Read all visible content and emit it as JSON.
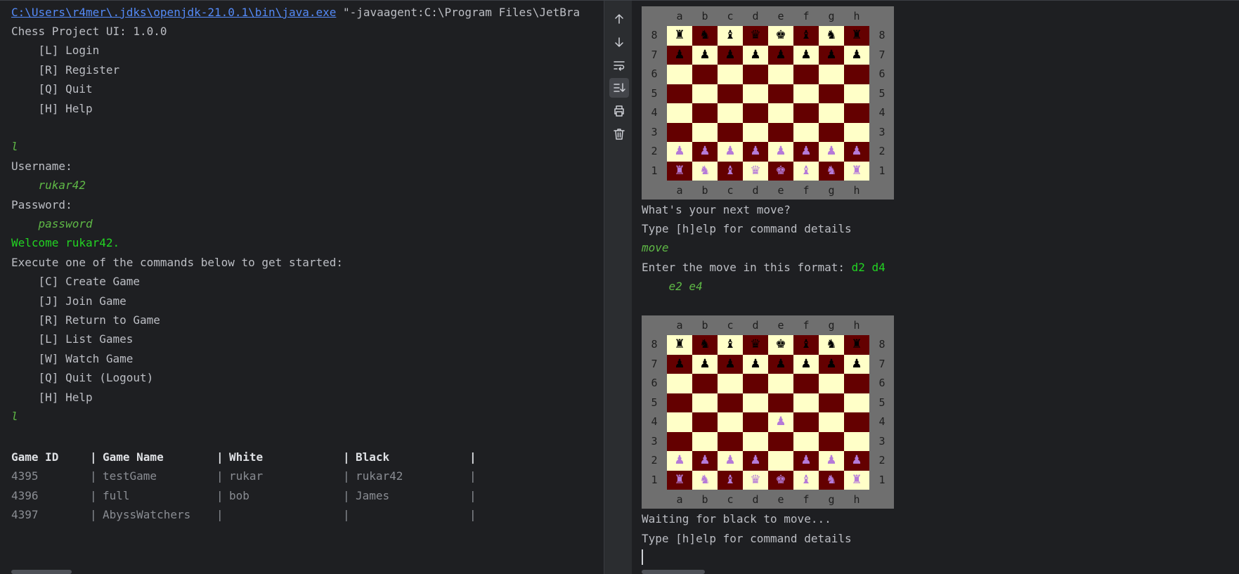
{
  "console_left": {
    "command_line": {
      "java_path": "C:\\Users\\r4mer\\.jdks\\openjdk-21.0.1\\bin\\java.exe",
      "args": " \"-javaagent:C:\\Program Files\\JetBra"
    },
    "lines": [
      {
        "text": "Chess Project UI: 1.0.0",
        "style": "normal"
      },
      {
        "text": "    [L] Login",
        "style": "normal"
      },
      {
        "text": "    [R] Register",
        "style": "normal"
      },
      {
        "text": "    [Q] Quit",
        "style": "normal"
      },
      {
        "text": "    [H] Help",
        "style": "normal"
      },
      {
        "text": "",
        "style": "normal"
      },
      {
        "text": "l",
        "style": "input"
      },
      {
        "text": "Username:",
        "style": "normal"
      },
      {
        "text": "    rukar42",
        "style": "input"
      },
      {
        "text": "Password:",
        "style": "normal"
      },
      {
        "text": "    password",
        "style": "input"
      },
      {
        "text": "Welcome rukar42.",
        "style": "success"
      },
      {
        "text": "Execute one of the commands below to get started:",
        "style": "normal"
      },
      {
        "text": "    [C] Create Game",
        "style": "normal"
      },
      {
        "text": "    [J] Join Game",
        "style": "normal"
      },
      {
        "text": "    [R] Return to Game",
        "style": "normal"
      },
      {
        "text": "    [L] List Games",
        "style": "normal"
      },
      {
        "text": "    [W] Watch Game",
        "style": "normal"
      },
      {
        "text": "    [Q] Quit (Logout)",
        "style": "normal"
      },
      {
        "text": "    [H] Help",
        "style": "normal"
      },
      {
        "text": "l",
        "style": "input"
      },
      {
        "text": "",
        "style": "normal"
      }
    ],
    "games_table": {
      "headers": [
        "Game ID",
        "Game Name",
        "White",
        "Black"
      ],
      "rows": [
        [
          "4395",
          "testGame",
          "rukar",
          "rukar42"
        ],
        [
          "4396",
          "full",
          "bob",
          "James"
        ],
        [
          "4397",
          "AbyssWatchers",
          "",
          ""
        ]
      ]
    }
  },
  "toolbar": {
    "items": [
      {
        "name": "scroll-up-icon",
        "active": false
      },
      {
        "name": "scroll-down-icon",
        "active": false
      },
      {
        "name": "soft-wrap-icon",
        "active": false
      },
      {
        "name": "scroll-to-end-icon",
        "active": true
      },
      {
        "name": "print-icon",
        "active": false
      },
      {
        "name": "clear-all-icon",
        "active": false
      }
    ]
  },
  "console_right": {
    "board_files": [
      "a",
      "b",
      "c",
      "d",
      "e",
      "f",
      "g",
      "h"
    ],
    "board_ranks": [
      "8",
      "7",
      "6",
      "5",
      "4",
      "3",
      "2",
      "1"
    ],
    "boards": [
      {
        "rows": [
          "rnbqkbnr",
          "pppppppp",
          "........",
          "........",
          "........",
          "........",
          "PPPPPPPP",
          "RNBQKBNR"
        ]
      },
      {
        "rows": [
          "rnbqkbnr",
          "pppppppp",
          "........",
          "........",
          "....P...",
          "........",
          "PPPP.PPP",
          "RNBQKBNR"
        ]
      }
    ],
    "after_board_1": {
      "prompt": "What's your next move?",
      "help_hint": "Type [h]elp for command details",
      "user_command": "move",
      "format_prompt": "Enter the move in this format: ",
      "format_example": "d2 d4",
      "user_move": "    e2 e4"
    },
    "after_board_2": {
      "status": "Waiting for black to move...",
      "help_hint": "Type [h]elp for command details"
    }
  },
  "colors": {
    "background": "#1e1f22",
    "toolbar": "#2b2d30",
    "text": "#bcbec4",
    "link": "#548af7",
    "user_input": "#5fb946",
    "success": "#22d422",
    "board_light": "#ffffc8",
    "board_dark": "#640000",
    "board_border": "#6f6f6f",
    "white_piece": "#b57ad8",
    "black_piece": "#000000"
  }
}
